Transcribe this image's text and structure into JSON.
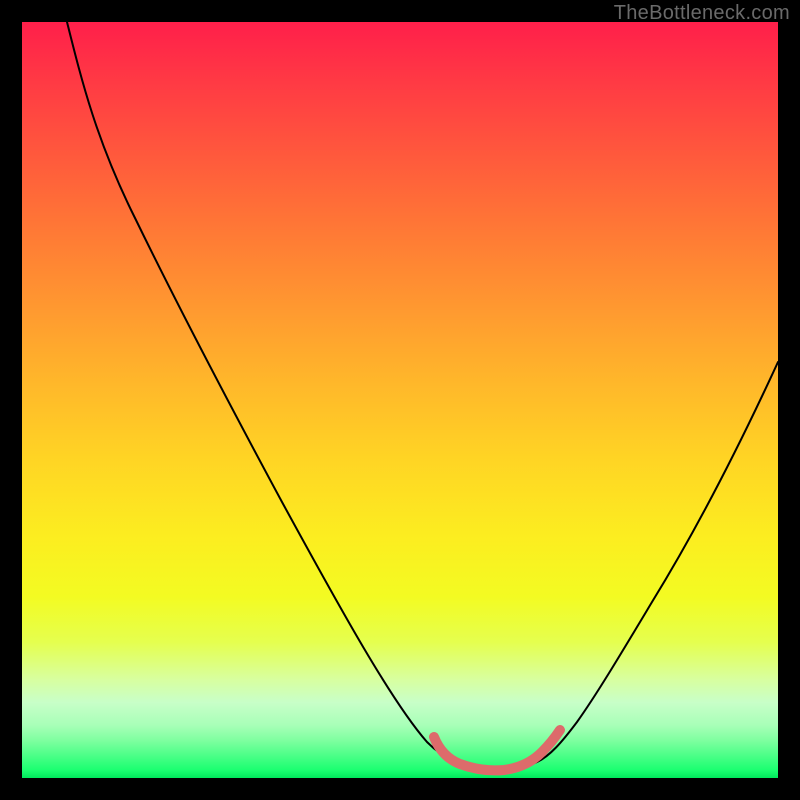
{
  "watermark": "TheBottleneck.com",
  "chart_data": {
    "type": "line",
    "title": "",
    "xlabel": "",
    "ylabel": "",
    "xlim": [
      0,
      100
    ],
    "ylim": [
      0,
      100
    ],
    "grid": false,
    "legend": false,
    "background_gradient": {
      "orientation": "vertical",
      "stops": [
        {
          "pos": 0,
          "color": "#ff1f4a"
        },
        {
          "pos": 50,
          "color": "#ffd524"
        },
        {
          "pos": 100,
          "color": "#00e85c"
        }
      ]
    },
    "series": [
      {
        "name": "bottleneck-curve",
        "color": "#000000",
        "stroke_width": 2,
        "x": [
          6,
          10,
          15,
          20,
          25,
          30,
          35,
          40,
          45,
          50,
          55,
          57,
          60,
          63,
          65,
          68,
          72,
          76,
          80,
          85,
          90,
          95,
          100
        ],
        "y": [
          100,
          92,
          83,
          74,
          66,
          57,
          49,
          40,
          31,
          22,
          12,
          8,
          3,
          1,
          1,
          3,
          8,
          14,
          20,
          28,
          37,
          46,
          56
        ]
      },
      {
        "name": "optimal-range-marker",
        "color": "#e06666",
        "stroke_width": 8,
        "x": [
          55,
          57,
          59,
          61,
          63,
          65,
          67,
          69,
          71
        ],
        "y": [
          8,
          4,
          2,
          1,
          1,
          1,
          2,
          4,
          8
        ]
      }
    ]
  }
}
